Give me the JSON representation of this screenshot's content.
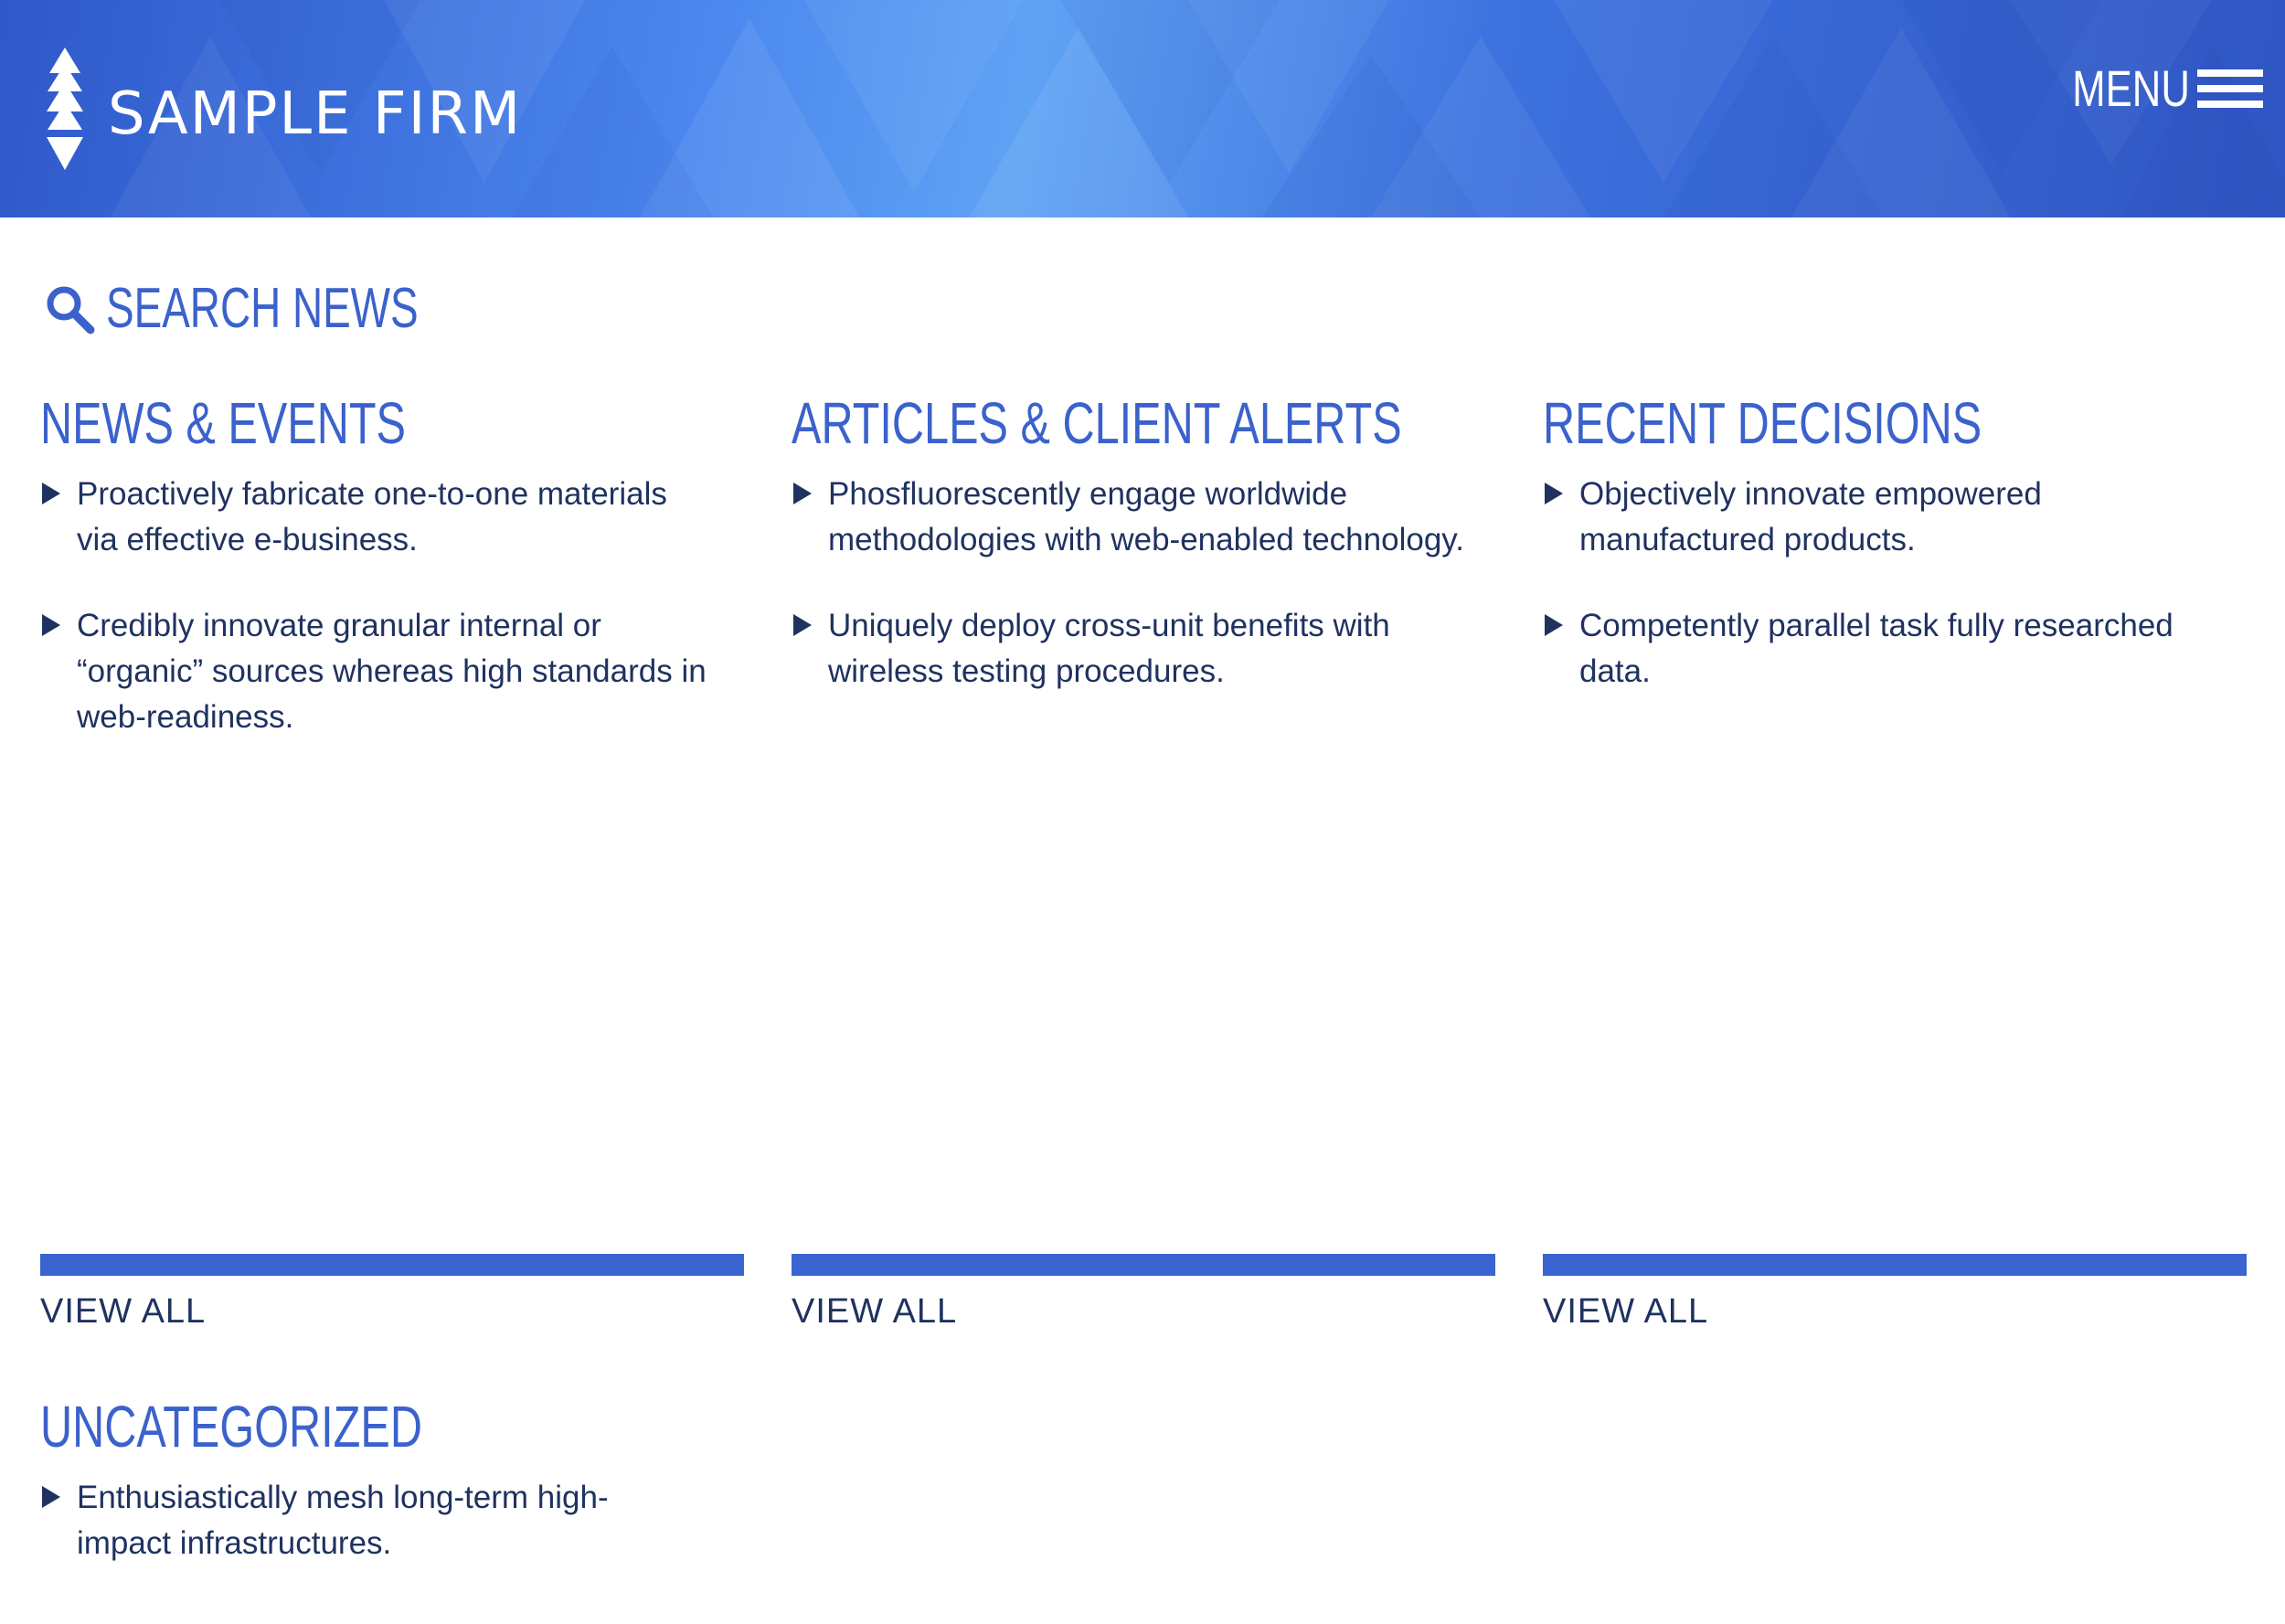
{
  "brand": {
    "name": "SAMPLE FIRM",
    "logo_icon": "tree-logo-icon",
    "header_color": "#3d72df",
    "accent": "#3b62cc",
    "text_color": "#1f3260"
  },
  "header": {
    "menu_label": "MENU",
    "menu_icon": "hamburger-icon"
  },
  "search": {
    "label": "SEARCH NEWS",
    "icon": "search-icon"
  },
  "sections": [
    {
      "title": "NEWS & EVENTS",
      "items": [
        "Proactively fabricate one-to-one materials via effective e-business.",
        "Credibly innovate granular internal or “organic” sources whereas high standards in web-readiness."
      ],
      "view_all": "VIEW ALL"
    },
    {
      "title": "ARTICLES & CLIENT ALERTS",
      "items": [
        "Phosfluorescently engage worldwide methodologies with web-enabled technology.",
        "Uniquely deploy cross-unit benefits with wireless testing procedures."
      ],
      "view_all": "VIEW ALL"
    },
    {
      "title": "RECENT DECISIONS",
      "items": [
        "Objectively innovate empowered manufactured products.",
        "Competently parallel task fully researched data."
      ],
      "view_all": "VIEW ALL"
    },
    {
      "title": "UNCATEGORIZED",
      "items": [
        "Enthusiastically mesh long-term high-impact infrastructures."
      ]
    }
  ]
}
